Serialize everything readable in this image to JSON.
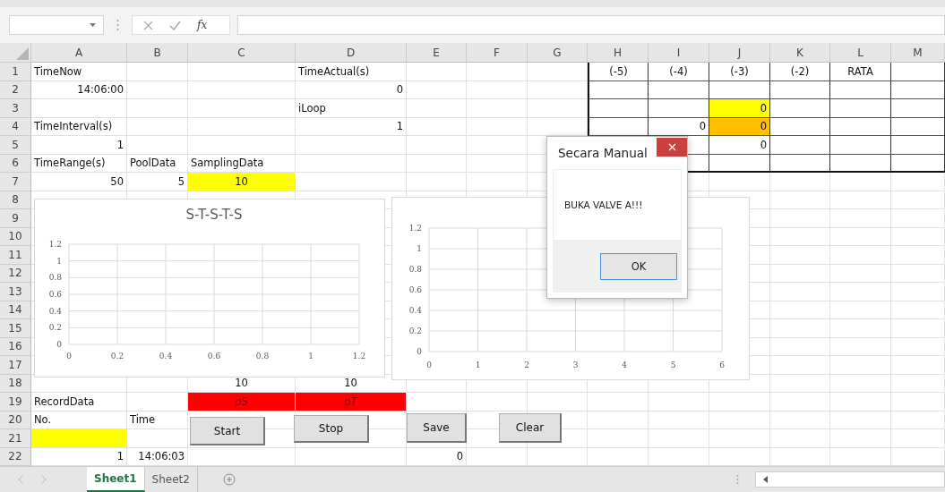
{
  "formula_bar": {
    "function_label": "fx"
  },
  "columns": [
    "A",
    "B",
    "C",
    "D",
    "E",
    "F",
    "G",
    "H",
    "I",
    "J",
    "K",
    "L",
    "M"
  ],
  "rows": [
    {
      "number": "1",
      "cells": {
        "a": {
          "text": "TimeNow",
          "kind": "text"
        },
        "d": {
          "text": "TimeActual(s)",
          "kind": "text"
        },
        "h": {
          "text": "(-5)",
          "kind": "center"
        },
        "i": {
          "text": "(-4)",
          "kind": "center"
        },
        "j": {
          "text": "(-3)",
          "kind": "center"
        },
        "k": {
          "text": "(-2)",
          "kind": "center"
        },
        "l": {
          "text": "RATA",
          "kind": "center"
        }
      }
    },
    {
      "number": "2",
      "cells": {
        "a": {
          "text": "14:06:00",
          "kind": "number"
        },
        "d": {
          "text": "0",
          "kind": "number"
        }
      }
    },
    {
      "number": "3",
      "cells": {
        "d": {
          "text": "iLoop",
          "kind": "text"
        },
        "j": {
          "text": "0",
          "kind": "number",
          "color": "#ffff00"
        }
      }
    },
    {
      "number": "4",
      "cells": {
        "a": {
          "text": "TimeInterval(s)",
          "kind": "text"
        },
        "d": {
          "text": "1",
          "kind": "number"
        },
        "i": {
          "text": "0",
          "kind": "number"
        },
        "j": {
          "text": "0",
          "kind": "number",
          "color": "#ffc000"
        }
      }
    },
    {
      "number": "5",
      "cells": {
        "a": {
          "text": "1",
          "kind": "number"
        },
        "j": {
          "text": "0",
          "kind": "number"
        }
      }
    },
    {
      "number": "6",
      "cells": {
        "a": {
          "text": "TimeRange(s)",
          "kind": "text"
        },
        "b": {
          "text": "PoolData",
          "kind": "text"
        },
        "c": {
          "text": "SamplingData",
          "kind": "text"
        }
      }
    },
    {
      "number": "7",
      "cells": {
        "a": {
          "text": "50",
          "kind": "number"
        },
        "b": {
          "text": "5",
          "kind": "number"
        },
        "c": {
          "text": "10",
          "kind": "center",
          "color": "#ffff00"
        }
      }
    },
    {
      "number": "8",
      "cells": {}
    },
    {
      "number": "9",
      "cells": {}
    },
    {
      "number": "10",
      "cells": {}
    },
    {
      "number": "11",
      "cells": {}
    },
    {
      "number": "12",
      "cells": {}
    },
    {
      "number": "13",
      "cells": {}
    },
    {
      "number": "14",
      "cells": {}
    },
    {
      "number": "15",
      "cells": {}
    },
    {
      "number": "16",
      "cells": {}
    },
    {
      "number": "17",
      "cells": {}
    },
    {
      "number": "18",
      "cells": {
        "c": {
          "text": "10",
          "kind": "center"
        },
        "d": {
          "text": "10",
          "kind": "center"
        }
      }
    },
    {
      "number": "19",
      "cells": {
        "a": {
          "text": "RecordData",
          "kind": "text"
        },
        "c": {
          "text": "pS",
          "kind": "italic",
          "color": "#ff0000"
        },
        "d": {
          "text": "pT",
          "kind": "italic",
          "color": "#ff0000"
        }
      }
    },
    {
      "number": "20",
      "cells": {
        "a": {
          "text": "No.",
          "kind": "text"
        },
        "b": {
          "text": "Time",
          "kind": "text"
        }
      }
    },
    {
      "number": "21",
      "cells": {
        "a": {
          "kind": "text",
          "color": "#ffff00"
        }
      }
    },
    {
      "number": "22",
      "cells": {
        "a": {
          "text": "1",
          "kind": "number"
        },
        "b": {
          "text": "14:06:03",
          "kind": "number"
        },
        "e": {
          "text": "0",
          "kind": "number"
        }
      }
    }
  ],
  "charts": [
    {
      "chart_data": {
        "type": "scatter",
        "grid": true,
        "title": "S-T-S-T-S",
        "xticks": [
          0,
          0.2,
          0.4,
          0.6,
          0.8,
          1,
          1.2
        ],
        "yticks": [
          0,
          0.2,
          0.4,
          0.6,
          0.8,
          1,
          1.2
        ],
        "xlim": [
          0,
          1.2
        ],
        "ylim": [
          0,
          1.2
        ]
      }
    },
    {
      "chart_data": {
        "type": "scatter",
        "grid": true,
        "xticks": [
          0,
          1,
          2,
          3,
          4,
          5,
          6
        ],
        "yticks": [
          0,
          0.2,
          0.4,
          0.6,
          0.8,
          1,
          1.2
        ],
        "xlim": [
          0,
          6
        ],
        "ylim": [
          0,
          1.2
        ]
      }
    }
  ],
  "buttons": [
    "Start",
    "Stop",
    "Save",
    "Clear"
  ],
  "dialog": {
    "title": "Secara Manual",
    "message": "BUKA VALVE A!!!",
    "button": "OK"
  },
  "sheet_tabs": [
    {
      "label": "Sheet1",
      "selected": true
    },
    {
      "label": "Sheet2",
      "selected": false
    }
  ]
}
